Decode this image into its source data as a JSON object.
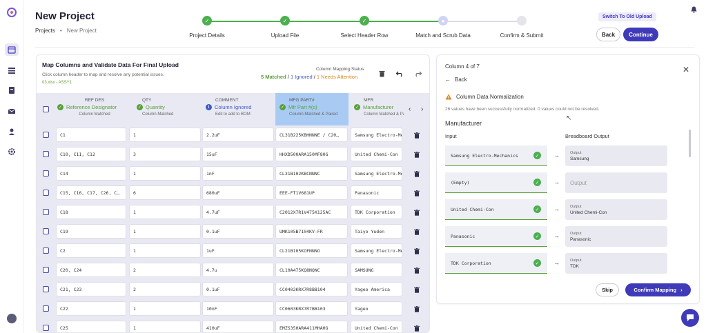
{
  "header": {
    "title": "New Project",
    "breadcrumb": [
      "Projects",
      "New Project"
    ],
    "switch_label": "Switch To Old Upload",
    "back_label": "Back",
    "continue_label": "Continue"
  },
  "steps": [
    {
      "label": "Project Details",
      "state": "done"
    },
    {
      "label": "Upload File",
      "state": "done"
    },
    {
      "label": "Select Header Row",
      "state": "done"
    },
    {
      "label": "Match and Scrub Data",
      "state": "current"
    },
    {
      "label": "Confirm & Submit",
      "state": "todo"
    }
  ],
  "mapping": {
    "title": "Map Columns and Validate Data For Final Upload",
    "subtitle": "Click column header to map and resolve any potential issues.",
    "file": "03.xlsx - ASSY1",
    "status_label": "Column Mapping Status",
    "matched": "5 Matched",
    "ignored": "1 Ignored",
    "attention": "1 Needs Attention",
    "sep": " / ",
    "columns": [
      {
        "source": "REF DES",
        "target": "Reference Designator",
        "note": "Column Matched",
        "icon": "check"
      },
      {
        "source": "QTY",
        "target": "Quantity",
        "note": "Column Matched",
        "icon": "check"
      },
      {
        "source": "COMMENT",
        "target": "Column Ignored",
        "note": "Edit to add to BOM",
        "icon": "info"
      },
      {
        "source": "MFG PART#",
        "target": "Mfr Part #(s)",
        "note": "Column Matched & Paired",
        "icon": "check"
      },
      {
        "source": "MFR",
        "target": "Manufacturer",
        "note": "Column Matched & Paired",
        "icon": "check"
      }
    ],
    "rows": [
      [
        "C1",
        "1",
        "2.2uF",
        "CL31B225KBHNNNE / C20…",
        "Samsung Electro-Me"
      ],
      [
        "C10, C11, C12",
        "3",
        "15uF",
        "HHXD500ARA150MF80G",
        "United Chemi-Con"
      ],
      [
        "C14",
        "1",
        "1nF",
        "CL31B102KBCNNNC",
        "Samsung Electro-Me"
      ],
      [
        "C15, C16, C17, C26, C…",
        "6",
        "680uF",
        "EEE-FT1V681UP",
        "Panasonic"
      ],
      [
        "C18",
        "1",
        "4.7uF",
        "C2012X7R1V475K125AC",
        "TDK Corporation"
      ],
      [
        "C19",
        "1",
        "0.1uF",
        "UMK105B7104KV-FR",
        "Taiyo Yuden"
      ],
      [
        "C2",
        "1",
        "1uF",
        "CL21B105KOFNNNG",
        "Samsung Electro-Me"
      ],
      [
        "C20, C24",
        "2",
        "4.7u",
        "CL10A475KQ8NQNC",
        "SAMSUNG"
      ],
      [
        "C21, C23",
        "2",
        "0.1uF",
        "CC0402KRX7R8BB104",
        "Yageo America"
      ],
      [
        "C22",
        "1",
        "10nF",
        "CC0603KRX7R7BB103",
        "Yageo"
      ],
      [
        "C25",
        "1",
        "410uF",
        "EMZS350ARA411MHA0G",
        "United Chemi-Con"
      ]
    ]
  },
  "panel": {
    "column_label": "Column 4 of 7",
    "back_label": "Back",
    "warn_title": "Column Data Normalization",
    "norm_text": "26 values have been successfully normalized. 0 values could not be resolved.",
    "field": "Manufacturer",
    "input_header": "Input",
    "output_header": "Breadboard Output",
    "output_label": "Output",
    "pairs": [
      {
        "input": "Samsung Electro-Mechanics",
        "output": "Samsung"
      },
      {
        "input": "(Empty)",
        "output": ""
      },
      {
        "input": "United Chemi-Con",
        "output": "United Chemi-Con"
      },
      {
        "input": "Panasonic",
        "output": "Panasonic"
      },
      {
        "input": "TDK Corporation",
        "output": "TDK"
      }
    ],
    "skip_label": "Skip",
    "confirm_label": "Confirm Mapping"
  },
  "colors": {
    "accent": "#3f3ab8",
    "success": "#4caf50",
    "warning": "#d48a1f",
    "info": "#3e5cc8"
  }
}
